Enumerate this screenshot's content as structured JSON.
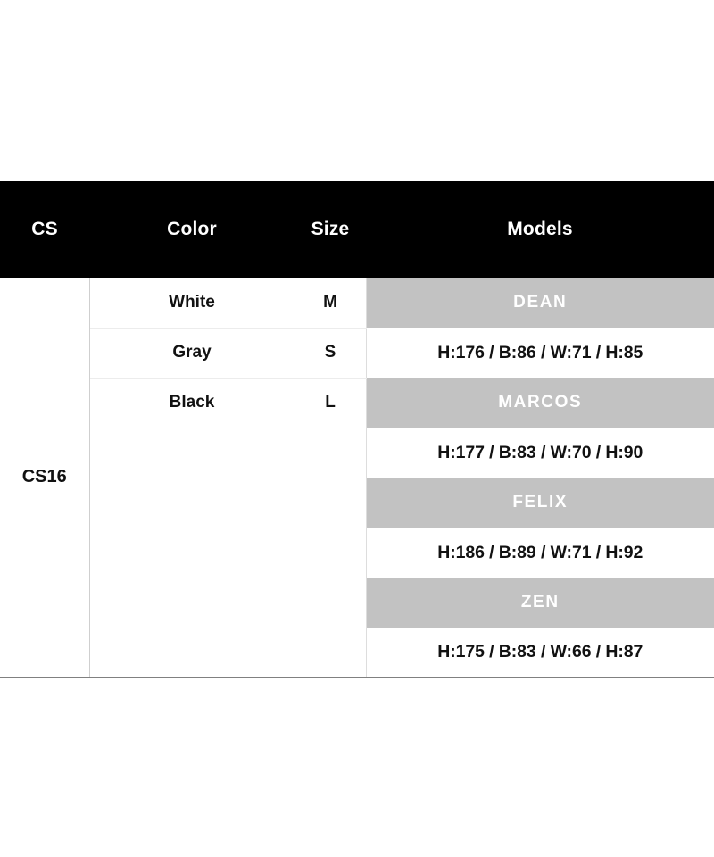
{
  "table": {
    "headers": [
      {
        "id": "cs",
        "label": "CS"
      },
      {
        "id": "color",
        "label": "Color"
      },
      {
        "id": "size",
        "label": "Size"
      },
      {
        "id": "models",
        "label": "Models"
      }
    ],
    "cs_group_label": "CS16",
    "colors": [
      "White",
      "Gray",
      "Black"
    ],
    "sizes": [
      "M",
      "S",
      "L"
    ],
    "models": [
      {
        "name": "DEAN",
        "measurements": "H:176 / B:86 / W:71 / H:85"
      },
      {
        "name": "MARCOS",
        "measurements": "H:177 / B:83 / W:70 / H:90"
      },
      {
        "name": "FELIX",
        "measurements": "H:186 / B:89 / W:71 / H:92"
      },
      {
        "name": "ZEN",
        "measurements": "H:175 / B:83 / W:66 / H:87"
      }
    ],
    "rows": [
      {
        "color": "White",
        "size": "M",
        "models_text": "DEAN",
        "models_style": "band"
      },
      {
        "color": "Gray",
        "size": "S",
        "models_text": "H:176 / B:86 / W:71 / H:85",
        "models_style": "plain"
      },
      {
        "color": "Black",
        "size": "L",
        "models_text": "MARCOS",
        "models_style": "band"
      },
      {
        "color": "",
        "size": "",
        "models_text": "H:177 / B:83 / W:70 / H:90",
        "models_style": "plain"
      },
      {
        "color": "",
        "size": "",
        "models_text": "FELIX",
        "models_style": "band"
      },
      {
        "color": "",
        "size": "",
        "models_text": "H:186 / B:89 / W:71 / H:92",
        "models_style": "plain"
      },
      {
        "color": "",
        "size": "",
        "models_text": "ZEN",
        "models_style": "band"
      },
      {
        "color": "",
        "size": "",
        "models_text": "H:175 / B:83 / W:66 / H:87",
        "models_style": "plain"
      }
    ],
    "colors_palette": {
      "header_bg": "#000000",
      "header_text": "#ffffff",
      "band_bg": "#c2c2c2",
      "band_text": "#ffffff",
      "cell_text": "#111111",
      "page_bg": "#ffffff"
    }
  }
}
